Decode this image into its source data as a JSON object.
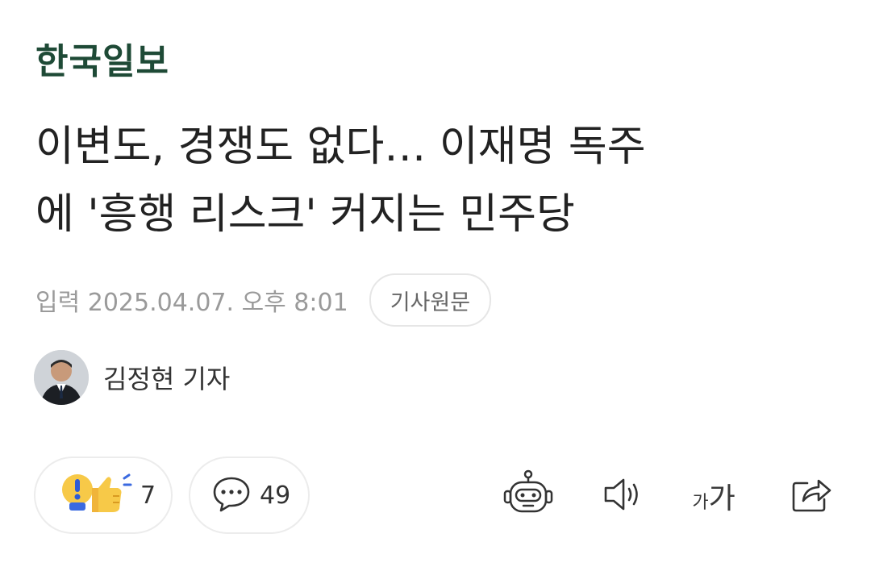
{
  "header": {
    "logo_text": "한국일보"
  },
  "article": {
    "headline_line1": "이변도, 경쟁도 없다… 이재명 독주",
    "headline_line2": "에 '흥행 리스크' 커지는 민주당",
    "published": "입력 2025.04.07. 오후 8:01",
    "original_button_label": "기사원문",
    "reporter_name": "김정현 기자"
  },
  "reactions": {
    "count": "7"
  },
  "comments": {
    "count": "49"
  },
  "toolbar": {
    "font_small_glyph": "가",
    "font_big_glyph": "가",
    "icons": [
      "robot-summary-icon",
      "speaker-icon",
      "font-size-icon",
      "share-icon"
    ]
  },
  "colors": {
    "logo": "#1e4a36",
    "date": "#9a9a9a",
    "pill_border": "#ececec"
  }
}
